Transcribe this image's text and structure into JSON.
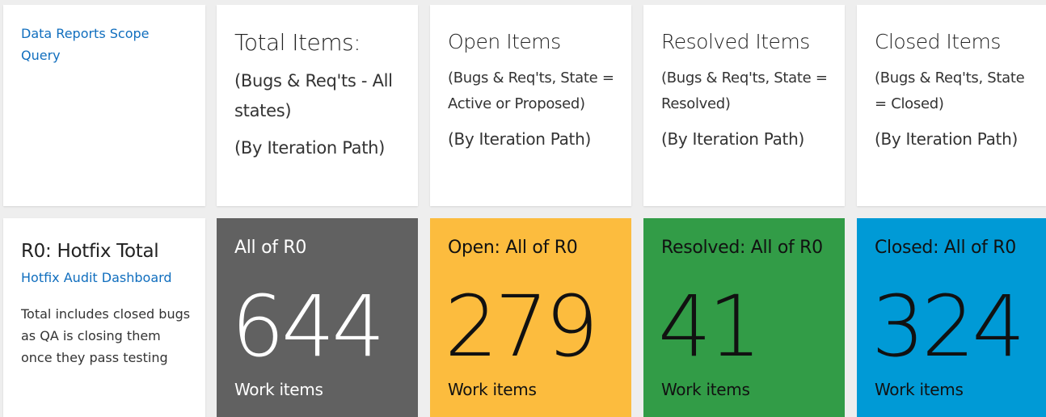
{
  "scope_tile": {
    "link": "Data Reports Scope Query"
  },
  "headers": [
    {
      "title": "Total Items:",
      "filter": "(Bugs & Req'ts - All states)",
      "grouping": "(By Iteration Path)"
    },
    {
      "title": "Open Items",
      "filter": "(Bugs & Req'ts, State = Active or Proposed)",
      "grouping": "(By Iteration Path)"
    },
    {
      "title": "Resolved Items",
      "filter": "(Bugs & Req'ts, State = Resolved)",
      "grouping": "(By Iteration Path)"
    },
    {
      "title": "Closed Items",
      "filter": "(Bugs & Req'ts, State = Closed)",
      "grouping": "(By Iteration Path)"
    }
  ],
  "r0_tile": {
    "title": "R0: Hotfix Total",
    "link": "Hotfix Audit Dashboard",
    "note": "Total includes closed bugs as QA is closing them once they pass testing"
  },
  "query_tiles": [
    {
      "title": "All of R0",
      "count": "644",
      "footer": "Work items",
      "color": "#616161"
    },
    {
      "title": "Open: All of R0",
      "count": "279",
      "footer": "Work items",
      "color": "#fcbc3e"
    },
    {
      "title": "Resolved: All of R0",
      "count": "41",
      "footer": "Work items",
      "color": "#329c47"
    },
    {
      "title": "Closed: All of R0",
      "count": "324",
      "footer": "Work items",
      "color": "#009ad6"
    }
  ]
}
